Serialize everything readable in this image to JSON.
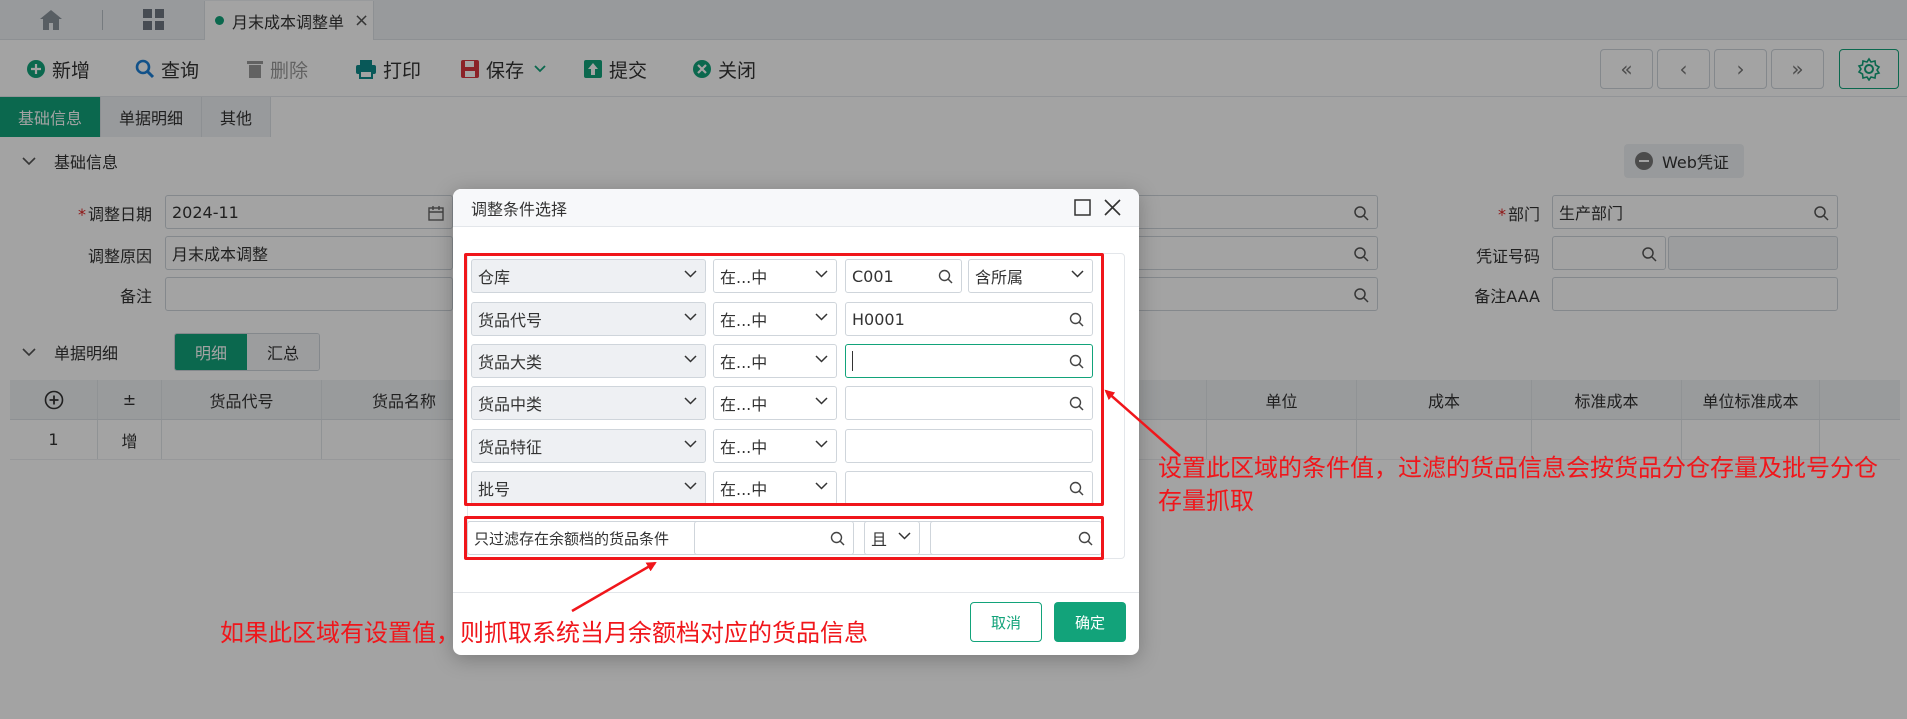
{
  "tabbar": {
    "doc_tab_label": "月末成本调整单",
    "close_glyph": "×"
  },
  "toolbar": {
    "new": "新增",
    "query": "查询",
    "delete": "删除",
    "print": "打印",
    "save": "保存",
    "submit": "提交",
    "close": "关闭",
    "nav": [
      "«",
      "‹",
      "›",
      "»"
    ]
  },
  "section_tabs": [
    "基础信息",
    "单据明细",
    "其他"
  ],
  "basic": {
    "title": "基础信息",
    "web_voucher": "Web凭证",
    "adjust_date_label": "调整日期",
    "adjust_date_value": "2024-11",
    "adjust_reason_label": "调整原因",
    "adjust_reason_value": "月末成本调整",
    "remark_label": "备注",
    "dept_label": "部门",
    "dept_value": "生产部门",
    "voucher_no_label": "凭证号码",
    "remark_aaa_label": "备注AAA"
  },
  "detail": {
    "title": "单据明细",
    "sub_tabs": [
      "明细",
      "汇总"
    ],
    "columns": [
      "±",
      "货品代号",
      "货品名称",
      "单位",
      "成本",
      "标准成本",
      "单位标准成本"
    ],
    "rows": [
      {
        "no": "1",
        "op": "增"
      }
    ]
  },
  "modal": {
    "title": "调整条件选择",
    "conditions": [
      {
        "field": "仓库",
        "op": "在...中",
        "value": "C001",
        "extra": "含所属"
      },
      {
        "field": "货品代号",
        "op": "在...中",
        "value": "H0001"
      },
      {
        "field": "货品大类",
        "op": "在...中",
        "value": ""
      },
      {
        "field": "货品中类",
        "op": "在...中",
        "value": ""
      },
      {
        "field": "货品特征",
        "op": "在...中",
        "value": ""
      },
      {
        "field": "批号",
        "op": "在...中",
        "value": ""
      }
    ],
    "balance_label": "只过滤存在余额档的货品条件",
    "balance_logic": "且",
    "cancel": "取消",
    "ok": "确定"
  },
  "annotations": {
    "right": "设置此区域的条件值，过滤的货品信息会按货品分仓存量及批号分仓存量抓取",
    "bottom": "如果此区域有设置值，则抓取系统当月余额档对应的货品信息"
  },
  "colors": {
    "accent": "#12a37a",
    "annotation": "#f0161b"
  }
}
